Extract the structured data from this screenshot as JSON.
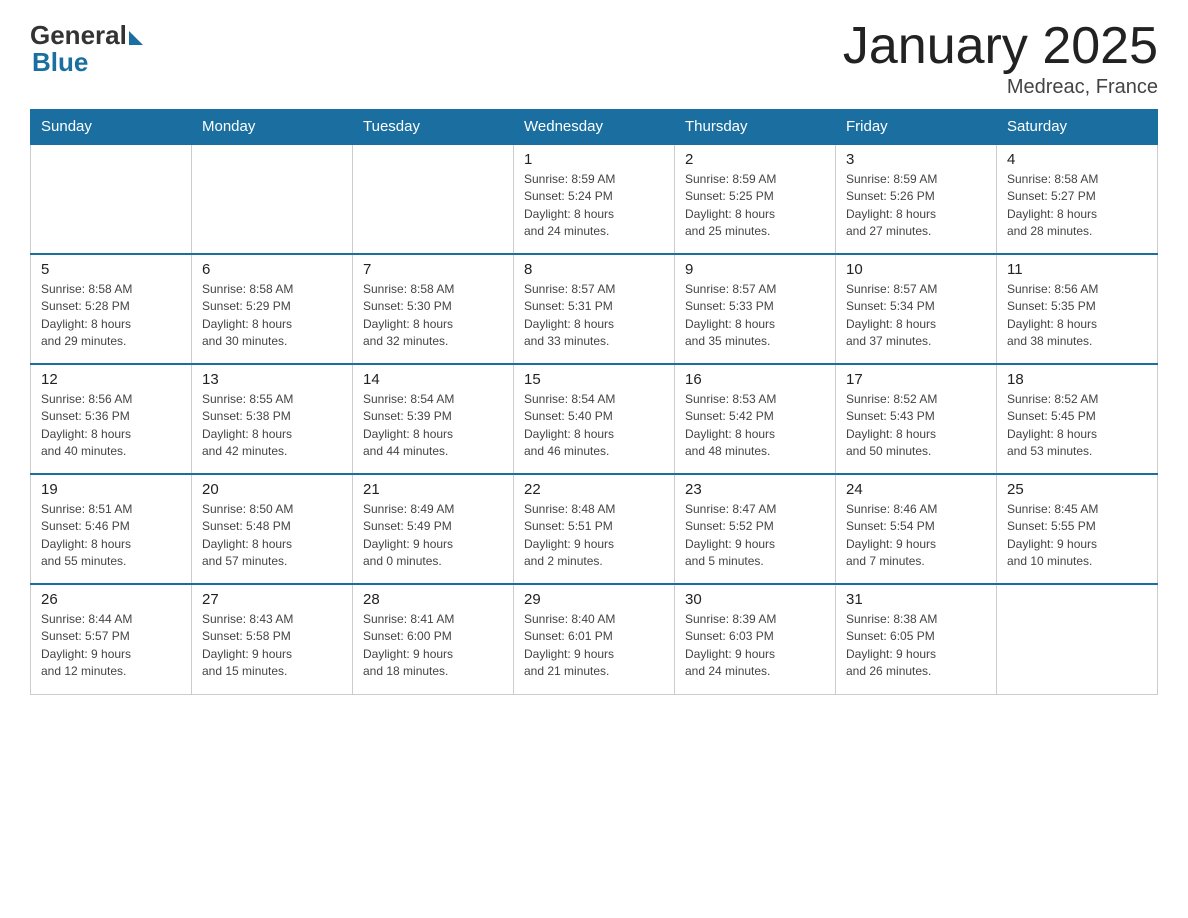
{
  "logo": {
    "general": "General",
    "blue": "Blue"
  },
  "title": "January 2025",
  "location": "Medreac, France",
  "days_header": [
    "Sunday",
    "Monday",
    "Tuesday",
    "Wednesday",
    "Thursday",
    "Friday",
    "Saturday"
  ],
  "weeks": [
    [
      {
        "day": "",
        "info": ""
      },
      {
        "day": "",
        "info": ""
      },
      {
        "day": "",
        "info": ""
      },
      {
        "day": "1",
        "info": "Sunrise: 8:59 AM\nSunset: 5:24 PM\nDaylight: 8 hours\nand 24 minutes."
      },
      {
        "day": "2",
        "info": "Sunrise: 8:59 AM\nSunset: 5:25 PM\nDaylight: 8 hours\nand 25 minutes."
      },
      {
        "day": "3",
        "info": "Sunrise: 8:59 AM\nSunset: 5:26 PM\nDaylight: 8 hours\nand 27 minutes."
      },
      {
        "day": "4",
        "info": "Sunrise: 8:58 AM\nSunset: 5:27 PM\nDaylight: 8 hours\nand 28 minutes."
      }
    ],
    [
      {
        "day": "5",
        "info": "Sunrise: 8:58 AM\nSunset: 5:28 PM\nDaylight: 8 hours\nand 29 minutes."
      },
      {
        "day": "6",
        "info": "Sunrise: 8:58 AM\nSunset: 5:29 PM\nDaylight: 8 hours\nand 30 minutes."
      },
      {
        "day": "7",
        "info": "Sunrise: 8:58 AM\nSunset: 5:30 PM\nDaylight: 8 hours\nand 32 minutes."
      },
      {
        "day": "8",
        "info": "Sunrise: 8:57 AM\nSunset: 5:31 PM\nDaylight: 8 hours\nand 33 minutes."
      },
      {
        "day": "9",
        "info": "Sunrise: 8:57 AM\nSunset: 5:33 PM\nDaylight: 8 hours\nand 35 minutes."
      },
      {
        "day": "10",
        "info": "Sunrise: 8:57 AM\nSunset: 5:34 PM\nDaylight: 8 hours\nand 37 minutes."
      },
      {
        "day": "11",
        "info": "Sunrise: 8:56 AM\nSunset: 5:35 PM\nDaylight: 8 hours\nand 38 minutes."
      }
    ],
    [
      {
        "day": "12",
        "info": "Sunrise: 8:56 AM\nSunset: 5:36 PM\nDaylight: 8 hours\nand 40 minutes."
      },
      {
        "day": "13",
        "info": "Sunrise: 8:55 AM\nSunset: 5:38 PM\nDaylight: 8 hours\nand 42 minutes."
      },
      {
        "day": "14",
        "info": "Sunrise: 8:54 AM\nSunset: 5:39 PM\nDaylight: 8 hours\nand 44 minutes."
      },
      {
        "day": "15",
        "info": "Sunrise: 8:54 AM\nSunset: 5:40 PM\nDaylight: 8 hours\nand 46 minutes."
      },
      {
        "day": "16",
        "info": "Sunrise: 8:53 AM\nSunset: 5:42 PM\nDaylight: 8 hours\nand 48 minutes."
      },
      {
        "day": "17",
        "info": "Sunrise: 8:52 AM\nSunset: 5:43 PM\nDaylight: 8 hours\nand 50 minutes."
      },
      {
        "day": "18",
        "info": "Sunrise: 8:52 AM\nSunset: 5:45 PM\nDaylight: 8 hours\nand 53 minutes."
      }
    ],
    [
      {
        "day": "19",
        "info": "Sunrise: 8:51 AM\nSunset: 5:46 PM\nDaylight: 8 hours\nand 55 minutes."
      },
      {
        "day": "20",
        "info": "Sunrise: 8:50 AM\nSunset: 5:48 PM\nDaylight: 8 hours\nand 57 minutes."
      },
      {
        "day": "21",
        "info": "Sunrise: 8:49 AM\nSunset: 5:49 PM\nDaylight: 9 hours\nand 0 minutes."
      },
      {
        "day": "22",
        "info": "Sunrise: 8:48 AM\nSunset: 5:51 PM\nDaylight: 9 hours\nand 2 minutes."
      },
      {
        "day": "23",
        "info": "Sunrise: 8:47 AM\nSunset: 5:52 PM\nDaylight: 9 hours\nand 5 minutes."
      },
      {
        "day": "24",
        "info": "Sunrise: 8:46 AM\nSunset: 5:54 PM\nDaylight: 9 hours\nand 7 minutes."
      },
      {
        "day": "25",
        "info": "Sunrise: 8:45 AM\nSunset: 5:55 PM\nDaylight: 9 hours\nand 10 minutes."
      }
    ],
    [
      {
        "day": "26",
        "info": "Sunrise: 8:44 AM\nSunset: 5:57 PM\nDaylight: 9 hours\nand 12 minutes."
      },
      {
        "day": "27",
        "info": "Sunrise: 8:43 AM\nSunset: 5:58 PM\nDaylight: 9 hours\nand 15 minutes."
      },
      {
        "day": "28",
        "info": "Sunrise: 8:41 AM\nSunset: 6:00 PM\nDaylight: 9 hours\nand 18 minutes."
      },
      {
        "day": "29",
        "info": "Sunrise: 8:40 AM\nSunset: 6:01 PM\nDaylight: 9 hours\nand 21 minutes."
      },
      {
        "day": "30",
        "info": "Sunrise: 8:39 AM\nSunset: 6:03 PM\nDaylight: 9 hours\nand 24 minutes."
      },
      {
        "day": "31",
        "info": "Sunrise: 8:38 AM\nSunset: 6:05 PM\nDaylight: 9 hours\nand 26 minutes."
      },
      {
        "day": "",
        "info": ""
      }
    ]
  ]
}
